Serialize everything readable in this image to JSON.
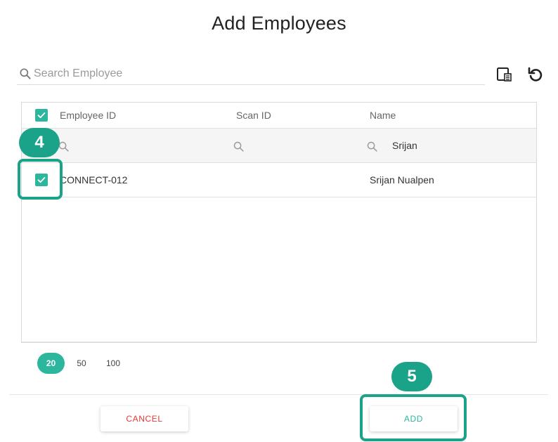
{
  "dialog": {
    "title": "Add Employees"
  },
  "search": {
    "placeholder": "Search Employee"
  },
  "toolbar": {
    "icons": [
      "column-chooser-icon",
      "refresh-icon"
    ]
  },
  "table": {
    "columns": [
      "Employee ID",
      "Scan ID",
      "Name"
    ],
    "filters": {
      "employee_id": "",
      "scan_id": "",
      "name": "Srijan"
    },
    "rows": [
      {
        "selected": true,
        "employee_id": "CONNECT-012",
        "scan_id": "",
        "name": "Srijan Nualpen"
      }
    ],
    "select_all": true
  },
  "pager": {
    "sizes": [
      "20",
      "50",
      "100"
    ],
    "active": "20"
  },
  "callouts": {
    "step4": "4",
    "step5": "5"
  },
  "buttons": {
    "cancel": "CANCEL",
    "add": "ADD"
  },
  "colors": {
    "accent": "#2db69e",
    "callout": "#1aa389",
    "cancel": "#e53935"
  }
}
